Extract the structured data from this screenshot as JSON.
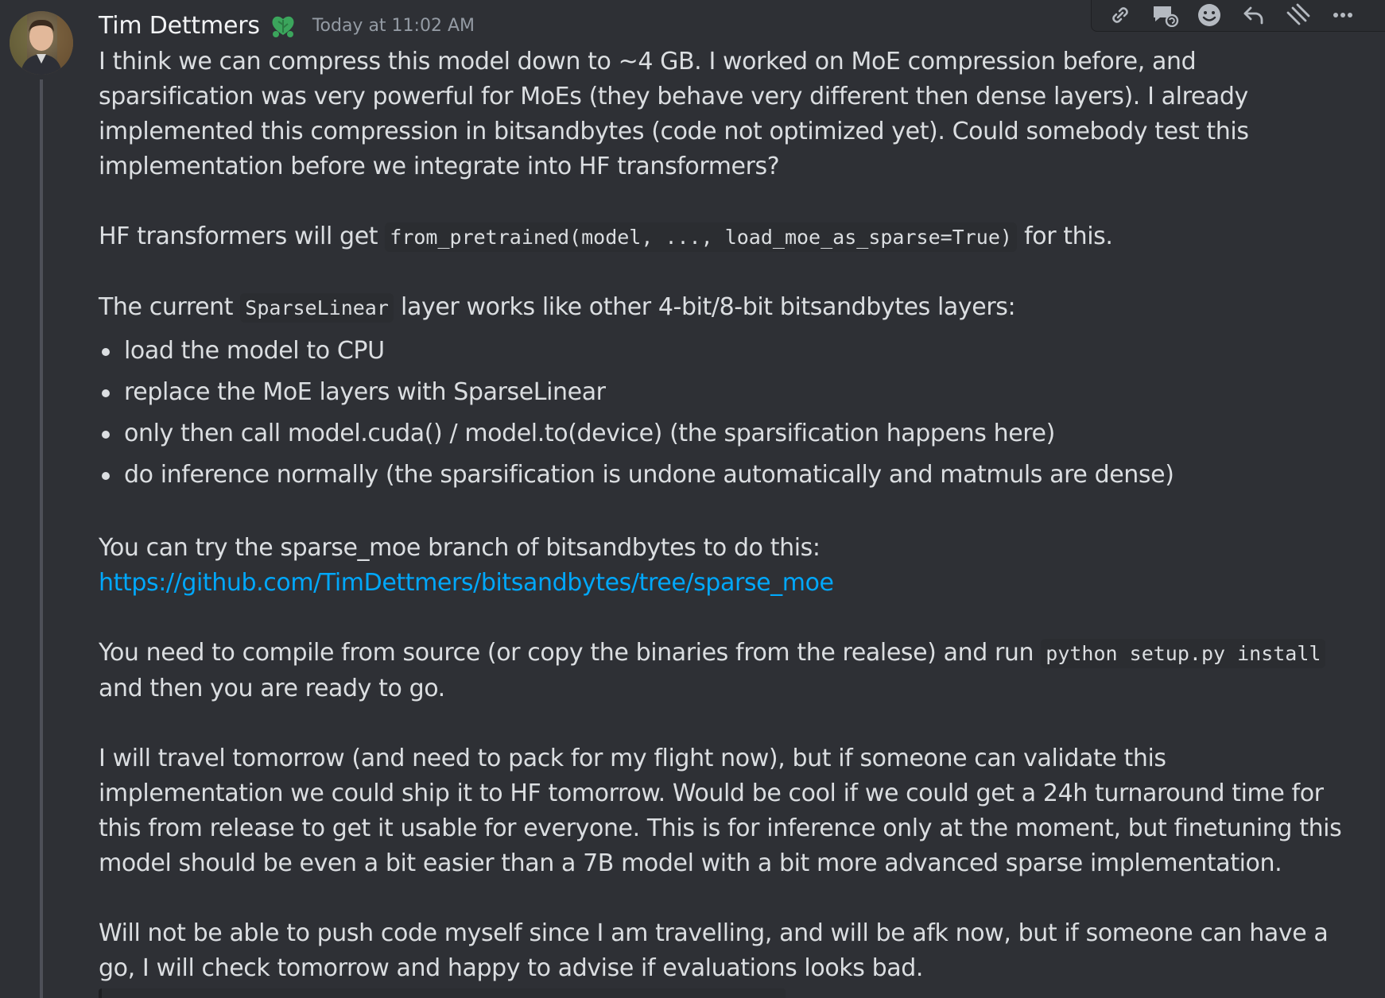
{
  "message": {
    "author": "Tim Dettmers",
    "timestamp": "Today at 11:02 AM",
    "avatar_icon": "avatar-photo",
    "role_icon": "green-leaf-heart-icon",
    "colors": {
      "background": "#2e3035",
      "text": "#dbdee1",
      "username": "#f2f3f5",
      "timestamp": "#949ba4",
      "link": "#00a8fc",
      "code_background": "#2b2d31",
      "role_icon": "#3ba55c"
    },
    "paragraph1": "I think we can compress this model down to ~4 GB. I worked on MoE compression before, and sparsification was very powerful for MoEs (they behave very different then dense layers). I already implemented this compression in bitsandbytes (code not optimized yet). Could somebody test this implementation before we integrate into HF transformers?",
    "paragraph2": {
      "before": "HF transformers will get ",
      "code": "from_pretrained(model, ..., load_moe_as_sparse=True)",
      "after": " for this."
    },
    "paragraph3": {
      "before": "The current ",
      "code": "SparseLinear",
      "after": " layer works like other 4-bit/8-bit bitsandbytes layers:"
    },
    "bullets": [
      "load the model to CPU",
      "replace the MoE layers with SparseLinear",
      "only then call model.cuda() / model.to(device) (the sparsification happens here)",
      "do inference normally (the sparsification is undone automatically and matmuls are dense)"
    ],
    "paragraph4": "You can try the sparse_moe branch of bitsandbytes to do this:",
    "link": "https://github.com/TimDettmers/bitsandbytes/tree/sparse_moe",
    "paragraph5": {
      "before": "You need to compile from source (or copy the binaries from the realese) and run ",
      "code": "python setup.py install",
      "after": " and then you are ready to go."
    },
    "paragraph6": "I will travel tomorrow (and need to pack for my flight now), but if someone can validate this implementation we could ship it to HF tomorrow. Would be cool if we could get a 24h turnaround time for this from release to get it usable for everyone. This is for inference only at the moment, but finetuning this model should be even a bit easier than a 7B model with a bit more advanced sparse implementation.",
    "paragraph7": "Will not be able to push code myself since I am travelling, and will be afk now, but if someone can have a go, I will check tomorrow and happy to advise if evaluations looks bad."
  },
  "toolbar": {
    "icons": [
      "link-icon",
      "thread-reply-icon",
      "add-reaction-icon",
      "reply-icon",
      "forward-icon",
      "more-icon"
    ]
  }
}
